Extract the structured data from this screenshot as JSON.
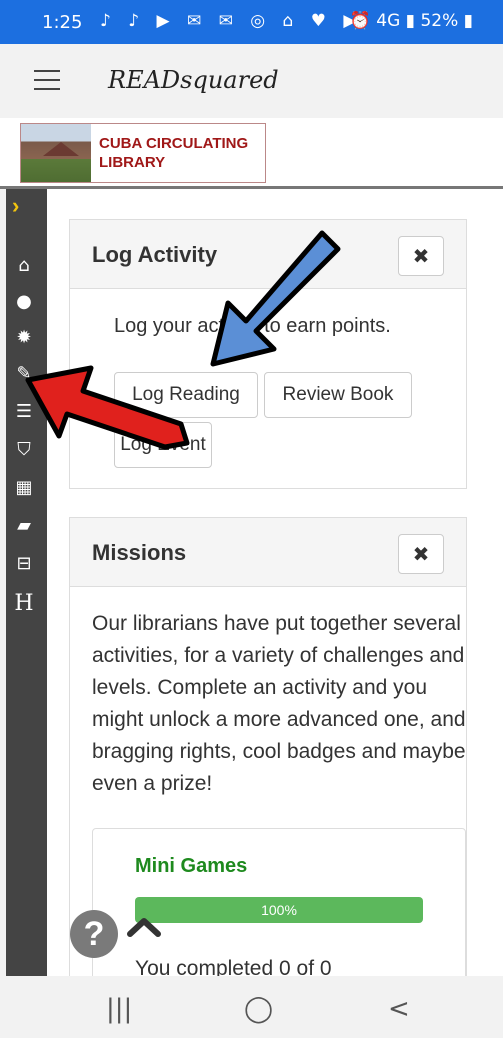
{
  "status": {
    "time": "1:25",
    "icons": "♪ ♪ ▶ ✉ ✉ ◎ ⌂ ♥ ▶",
    "right": "⏰ 4G ▮ 52% ▮"
  },
  "app": {
    "title": "READsquared"
  },
  "library": {
    "name_line1": "CUBA CIRCULATING",
    "name_line2": "LIBRARY"
  },
  "sidebar": {
    "chevron": "›",
    "icons": [
      "home-icon",
      "user-icon",
      "gear-icon",
      "pencil-icon",
      "list-icon",
      "shield-icon",
      "calendar-icon",
      "book-icon",
      "open-book-icon",
      "h-icon"
    ]
  },
  "log_activity": {
    "title": "Log Activity",
    "close": "✖",
    "lead": "Log your activity to earn points.",
    "buttons": [
      "Log Reading",
      "Review Book",
      "Log Event"
    ]
  },
  "missions": {
    "title": "Missions",
    "close": "✖",
    "description": "Our librarians have put together several activities, for a variety of challenges and levels. Complete an activity and you might unlock a more advanced one, and bragging rights, cool badges and maybe even a prize!",
    "mini_games": {
      "title": "Mini Games",
      "progress": 100,
      "progress_label": "100%",
      "note": "You completed 0 of 0"
    }
  },
  "help": {
    "label": "?"
  },
  "nav": {
    "recent": "|||",
    "home": "◯",
    "back": "<"
  }
}
